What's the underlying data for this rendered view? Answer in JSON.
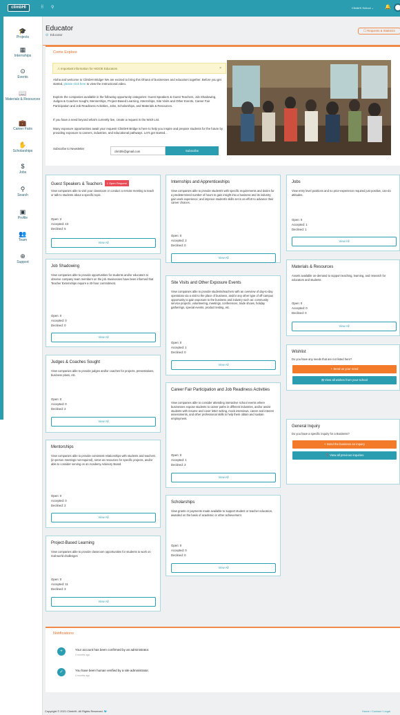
{
  "topbar": {
    "logo": "climbHI",
    "school": "ClimbHI School ⌄"
  },
  "sidebar": {
    "items": [
      {
        "label": "Projects",
        "icon": "graduation-cap-icon",
        "glyph": "🎓"
      },
      {
        "label": "Internships",
        "icon": "building-icon",
        "glyph": "▦"
      },
      {
        "label": "Events",
        "icon": "map-pin-icon",
        "glyph": "⊙"
      },
      {
        "label": "Materials & Resources",
        "icon": "book-icon",
        "glyph": "📖"
      },
      {
        "label": "Career Fairs",
        "icon": "briefcase-icon",
        "glyph": "💼"
      },
      {
        "label": "Scholarships",
        "icon": "hand-coins-icon",
        "glyph": "✋"
      },
      {
        "label": "Jobs",
        "icon": "dollar-icon",
        "glyph": "$"
      },
      {
        "label": "Search",
        "icon": "search-icon",
        "glyph": "⚲"
      },
      {
        "label": "Profile",
        "icon": "id-card-icon",
        "glyph": "▣"
      },
      {
        "label": "Team",
        "icon": "team-icon",
        "glyph": "👥"
      },
      {
        "label": "Support",
        "icon": "lifebuoy-icon",
        "glyph": "⊕"
      }
    ]
  },
  "header": {
    "title": "Educator",
    "breadcrumb": "Educator",
    "requests_button": "☐ Requests & Statistics"
  },
  "explore": {
    "title": "Come Explore",
    "alert": "⚠ Important information for HIDOE Educators",
    "alert_close": "×",
    "p1_a": "Aloha and welcome to ClimbHI Bridge! We are excited to bring this Ohana of businesses and educators together. Before you get started, ",
    "p1_link": "please click here",
    "p1_b": " to view the instructional video.",
    "p2": "Explore the companies available in the following opportunity categories: Guest Speakers & Guest Teachers, Job Shadowing, Judges & Coaches Sought, Mentorships, Project-Based Learning, Internships, Site Visits and Other Events, Career Fair Participation and Job Readiness Activities, Jobs, Scholarships, and Materials & Resources.",
    "p3": "If you have a need beyond what's currently live, create a request in the Wish List.",
    "p4": "Many exposure opportunities await your request! ClimbHI Bridge is here to help you inspire and prepare students for the future by providing exposure to careers, industries, and educational pathways. Let's get started...",
    "newsletter_label": "Subscribe to Newsletter",
    "newsletter_email": "climbhi@gmail.com",
    "subscribe": "Subscribe"
  },
  "cards": {
    "guest": {
      "title": "Guest Speakers & Teachers",
      "badge": "1 Open Request",
      "desc": "View companies able to visit your classroom or conduct a remote meeting to teach or talk to students about a specific topic.",
      "open": "Open: 2",
      "accepted": "Accepted: 43",
      "declined": "Declined: 5",
      "btn": "View All"
    },
    "shadow": {
      "title": "Job Shadowing",
      "desc": "View companies able to provide opportunities for students and/or educators to observe company team members on the job. Businesses have been informed that Teacher Externships require a 40-hour commitment.",
      "open": "Open: 0",
      "accepted": "Accepted: 0",
      "declined": "Declined: 0",
      "btn": "View All"
    },
    "judges": {
      "title": "Judges & Coaches Sought",
      "desc": "View companies able to provide judges and/or coaches for projects, presentations, business plans, etc.",
      "open": "Open: 0",
      "accepted": "Accepted: 0",
      "declined": "Declined: 2",
      "btn": "View All"
    },
    "mentor": {
      "title": "Mentorships",
      "desc": "View companies able to provide consistent relationships with students and teachers (in-person meetings not required), serve as resources for specific projects, and/or able to consider serving on an Academy Advisory Board.",
      "open": "Open: 0",
      "accepted": "Accepted: 0",
      "declined": "Declined: 2",
      "btn": "View All"
    },
    "pbl": {
      "title": "Project-Based Learning",
      "desc": "View companies able to provide classroom opportunities for students to work on real-world challenges",
      "open": "Open: 0",
      "accepted": "Accepted: 11",
      "declined": "Declined: 3",
      "btn": "View All"
    },
    "intern": {
      "title": "Internships and Apprenticeships",
      "desc": "View companies able to provide student/s with specific requirements and duties for a predetermined number of hours to gain insight into a business and its industry; gain work experience; and improve student/s skills set in an effort to advance their career choices.",
      "open": "Open: 0",
      "accepted": "Accepted: 2",
      "declined": "Declined: 0",
      "btn": "View All"
    },
    "site": {
      "title": "Site Visits and Other Exposure Events",
      "desc": "View companies able to provide students/teachers with an overview of day-to-day operations via a visit to the place of business, and/or any other type of off-campus opportunity to gain exposure to the business and industry such as: community service projects, volunteering, meetings, conferences, trade shows, holiday gatherings, special events, product testing, etc.",
      "open": "Open: 0",
      "accepted": "Accepted: 1",
      "declined": "Declined: 0",
      "btn": "View All"
    },
    "fair": {
      "title": "Career Fair Participation and Job Readiness Activities",
      "desc": "View companies able to consider attending interactive school events where businesses expose students to career paths in different industries, and/or assist students with resume and cover letter writing, mock interviews, career and interest assessments, and other professional skills to help them obtain and sustain employment.",
      "open": "Open: 0",
      "accepted": "Accepted: 1",
      "declined": "Declined: 3",
      "btn": "View All"
    },
    "schol": {
      "title": "Scholarships",
      "desc": "View grants or payments made available to support student or teacher education, awarded on the basis of academic or other achievement.",
      "open": "Open: 0",
      "accepted": "Accepted: 0",
      "declined": "Declined: 0",
      "btn": "View All"
    },
    "jobs": {
      "title": "Jobs",
      "desc": "View entry level positions and no prior-experience required just positive, can-do attitudes.",
      "open": "Open: 0",
      "accepted": "Accepted: 1",
      "declined": "Declined: 1",
      "btn": "View All"
    },
    "mat": {
      "title": "Materials & Resources",
      "desc": "Assets available on-demand to support teaching, learning, and research for educators and students",
      "open": "Open: 0",
      "accepted": "Accepted: 0",
      "declined": "Declined: 0",
      "btn": "View All"
    },
    "wish": {
      "title": "Wishlist",
      "desc": "Do you have any needs that are not listed here?",
      "btn1": "+ Send us your need",
      "btn2": "⊞ View all wishes from your school"
    },
    "inquiry": {
      "title": "General Inquiry",
      "desc": "Do you have a specific inquiry for a Business?",
      "btn1": "+ Send the business an inquiry",
      "btn2": "❓ View all previous inquiries"
    }
  },
  "notifications": {
    "title": "Notifications",
    "items": [
      {
        "text": "Your account has been confirmed by an administrator.",
        "time": "4 months ago"
      },
      {
        "text": "You have been human verified by a site administrator.",
        "time": "4 months ago"
      }
    ]
  },
  "footer": {
    "left": "Copyright © 2021 ClimbHI. All Rights Reserved.",
    "right": "Home  /  Contact  /  Legal"
  }
}
